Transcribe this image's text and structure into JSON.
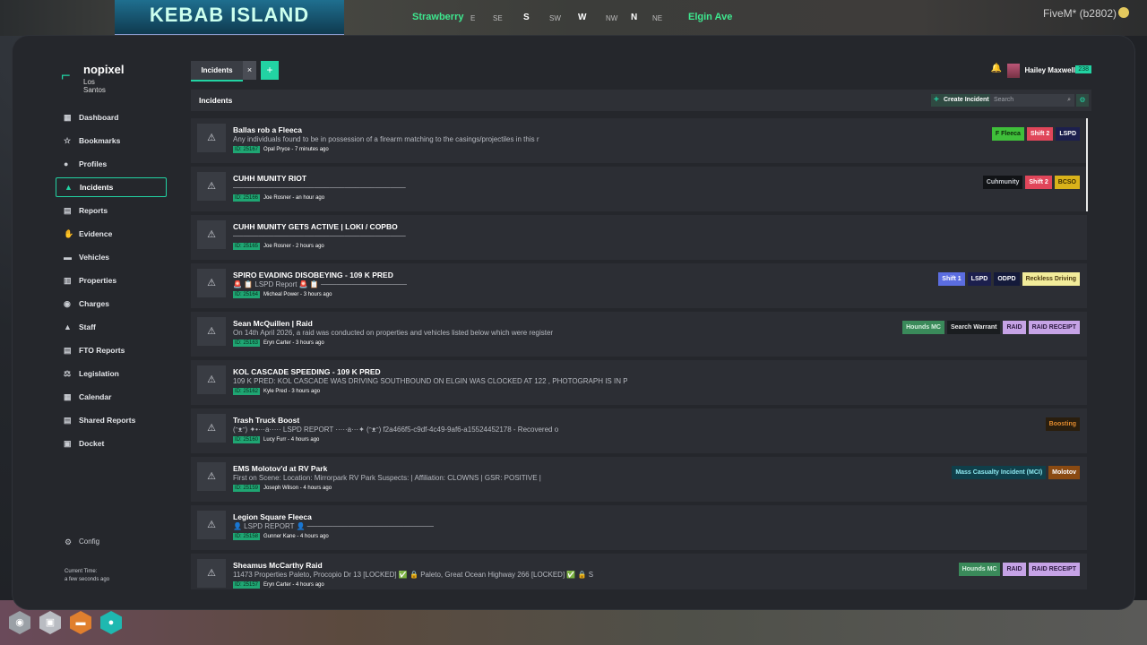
{
  "game": {
    "sign_text": "KEBAB ISLAND",
    "street_left": "Strawberry",
    "street_right": "Elgin Ave",
    "compass": [
      "E",
      "SE",
      "S",
      "SW",
      "W",
      "NW",
      "N",
      "NE"
    ],
    "client_label": "FiveM* (b2802)"
  },
  "brand": {
    "name": "nopixel",
    "subtitle": "Los Santos"
  },
  "sidebar": {
    "items": [
      {
        "label": "Dashboard",
        "icon": "grid-icon"
      },
      {
        "label": "Bookmarks",
        "icon": "star-icon"
      },
      {
        "label": "Profiles",
        "icon": "person-icon"
      },
      {
        "label": "Incidents",
        "icon": "warning-icon",
        "active": true
      },
      {
        "label": "Reports",
        "icon": "document-icon"
      },
      {
        "label": "Evidence",
        "icon": "fingerprint-icon"
      },
      {
        "label": "Vehicles",
        "icon": "car-icon"
      },
      {
        "label": "Properties",
        "icon": "building-icon"
      },
      {
        "label": "Charges",
        "icon": "pin-icon"
      },
      {
        "label": "Staff",
        "icon": "hat-icon"
      },
      {
        "label": "FTO Reports",
        "icon": "document-icon"
      },
      {
        "label": "Legislation",
        "icon": "gavel-icon"
      },
      {
        "label": "Calendar",
        "icon": "calendar-icon"
      },
      {
        "label": "Shared Reports",
        "icon": "document-icon"
      },
      {
        "label": "Docket",
        "icon": "folder-icon"
      }
    ],
    "config_label": "Config",
    "time_label": "Current Time:",
    "time_value": "a few seconds ago"
  },
  "tabs": {
    "active_label": "Incidents",
    "close_label": "×",
    "add_label": "+"
  },
  "user": {
    "name": "Hailey Maxwell",
    "callsign": "238"
  },
  "header": {
    "title": "Incidents",
    "create_label": "Create Incident",
    "search_placeholder": "Search"
  },
  "incidents": [
    {
      "title": "Ballas rob a Fleeca",
      "desc": "Any individuals found to be in possession of a firearm matching to the casings/projectiles in this r",
      "id": "ID: 25167",
      "meta": "Opal Pryce - 7 minutes ago",
      "tags": [
        {
          "label": "F Fleeca",
          "bg": "#3fbf3a",
          "fg": "#0c2a0a"
        },
        {
          "label": "Shift 2",
          "bg": "#e0465a",
          "fg": "#fff"
        },
        {
          "label": "LSPD",
          "bg": "#1c1f4d",
          "fg": "#fff"
        }
      ]
    },
    {
      "title": "CUHH MUNITY RIOT",
      "desc": "──────────────────────────────────",
      "id": "ID: 25166",
      "meta": "Joe Rosner - an hour ago",
      "tags": [
        {
          "label": "Cuhmunity",
          "bg": "#111316",
          "fg": "#c9ccd2"
        },
        {
          "label": "Shift 2",
          "bg": "#e0465a",
          "fg": "#fff"
        },
        {
          "label": "BCSO",
          "bg": "#d9b21a",
          "fg": "#3a2c00"
        }
      ]
    },
    {
      "title": "CUHH MUNITY GETS ACTIVE | LOKI / COPBO",
      "desc": "──────────────────────────────────",
      "id": "ID: 25165",
      "meta": "Joe Rosner - 2 hours ago",
      "tags": []
    },
    {
      "title": "SPIRO EVADING DISOBEYING - 109 K PRED",
      "desc": "🚨 📋 LSPD Report 🚨 📋 ─────────────────",
      "id": "ID: 25164",
      "meta": "Micheal Power - 3 hours ago",
      "tags": [
        {
          "label": "Shift 1",
          "bg": "#5b6de0",
          "fg": "#fff"
        },
        {
          "label": "LSPD",
          "bg": "#1c1f4d",
          "fg": "#fff"
        },
        {
          "label": "ODPD",
          "bg": "#141a3a",
          "fg": "#fff"
        },
        {
          "label": "Reckless Driving",
          "bg": "#f2ec9a",
          "fg": "#4a3a10"
        }
      ]
    },
    {
      "title": "Sean McQuillen | Raid",
      "desc": "On 14th April 2026, a raid was conducted on properties and vehicles listed below which were register",
      "id": "ID: 25163",
      "meta": "Eryn Carter - 3 hours ago",
      "tags": [
        {
          "label": "Hounds MC",
          "bg": "#3a8a5a",
          "fg": "#d8f0e0"
        },
        {
          "label": "Search Warrant",
          "bg": "#1a1d20",
          "fg": "#e8e8e8"
        },
        {
          "label": "RAID",
          "bg": "#c6a3e6",
          "fg": "#2c1a40"
        },
        {
          "label": "RAID RECEIPT",
          "bg": "#c6a3e6",
          "fg": "#2c1a40"
        }
      ]
    },
    {
      "title": "KOL CASCADE SPEEDING - 109 K PRED",
      "desc": "109 K PRED: KOL CASCADE WAS DRIVING SOUTHBOUND ON ELGIN WAS CLOCKED AT 122 , PHOTOGRAPH IS IN PERSO",
      "id": "ID: 25162",
      "meta": "Kyle Pred - 3 hours ago",
      "tags": []
    },
    {
      "title": "Trash Truck Boost",
      "desc": "(ᵔᴥᵔ) ✦•···a····· LSPD REPORT ·····a···✦ (ᵔᴥᵔ) f2a466f5-c9df-4c49-9af6-a15524452178 - Recovered o",
      "id": "ID: 25160",
      "meta": "Lucy Furr - 4 hours ago",
      "tags": [
        {
          "label": "Boosting",
          "bg": "#2a1e0e",
          "fg": "#e08a2e"
        }
      ]
    },
    {
      "title": "EMS Molotov'd at RV Park",
      "desc": "First on Scene: Location: Mirrorpark RV Park Suspects: | Affiliation: CLOWNS | GSR: POSITIVE |",
      "id": "ID: 25159",
      "meta": "Joseph Wilson - 4 hours ago",
      "tags": [
        {
          "label": "Mass Casualty Incident (MCI)",
          "bg": "#0f3f4a",
          "fg": "#8ee8ef"
        },
        {
          "label": "Molotov",
          "bg": "#8a4a12",
          "fg": "#fff"
        }
      ]
    },
    {
      "title": "Legion Square Fleeca",
      "desc": "👤 LSPD REPORT 👤 ─────────────────────────",
      "id": "ID: 25158",
      "meta": "Gunner Kane - 4 hours ago",
      "tags": []
    },
    {
      "title": "Sheamus McCarthy Raid",
      "desc": "11473 Properties Paleto, Procopio Dr 13 [LOCKED] ✅ 🔒 Paleto, Great Ocean Highway 266 [LOCKED] ✅ 🔒 S",
      "id": "ID: 25157",
      "meta": "Eryn Carter - 4 hours ago",
      "tags": [
        {
          "label": "Hounds MC",
          "bg": "#3a8a5a",
          "fg": "#d8f0e0"
        },
        {
          "label": "RAID",
          "bg": "#c6a3e6",
          "fg": "#2c1a40"
        },
        {
          "label": "RAID RECEIPT",
          "bg": "#c6a3e6",
          "fg": "#2c1a40"
        }
      ]
    }
  ]
}
